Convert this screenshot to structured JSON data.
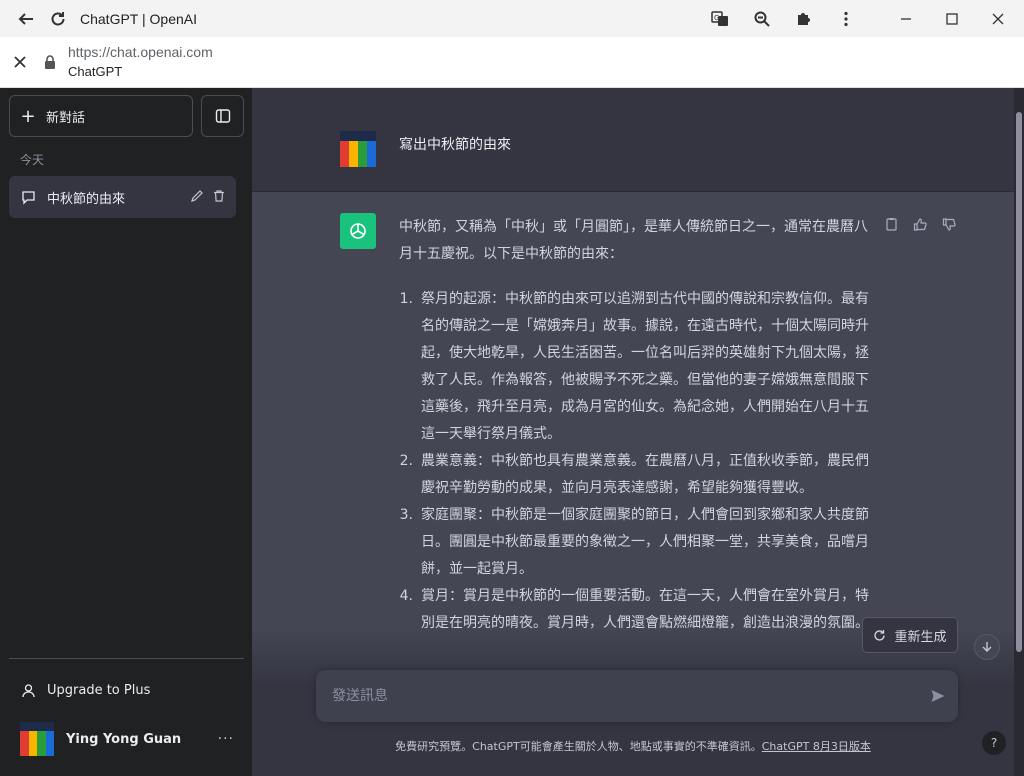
{
  "browser": {
    "tab_title": "ChatGPT | OpenAI",
    "url": "https://chat.openai.com",
    "site_name": "ChatGPT"
  },
  "sidebar": {
    "new_chat_label": "新對話",
    "section_today": "今天",
    "conversations": [
      {
        "title": "中秋節的由來"
      }
    ],
    "upgrade_label": "Upgrade to Plus",
    "user_name": "Ying Yong Guan",
    "more_label": "···"
  },
  "chat": {
    "user_message": "寫出中秋節的由來",
    "assistant_intro": "中秋節，又稱為「中秋」或「月圓節」，是華人傳統節日之一，通常在農曆八月十五慶祝。以下是中秋節的由來：",
    "assistant_list": [
      {
        "num": "1.",
        "text": "祭月的起源：中秋節的由來可以追溯到古代中國的傳說和宗教信仰。最有名的傳說之一是「嫦娥奔月」故事。據說，在遠古時代，十個太陽同時升起，使大地乾旱，人民生活困苦。一位名叫后羿的英雄射下九個太陽，拯救了人民。作為報答，他被賜予不死之藥。但當他的妻子嫦娥無意間服下這藥後，飛升至月亮，成為月宮的仙女。為紀念她，人們開始在八月十五這一天舉行祭月儀式。"
      },
      {
        "num": "2.",
        "text": "農業意義：中秋節也具有農業意義。在農曆八月，正值秋收季節，農民們慶祝辛勤勞動的成果，並向月亮表達感謝，希望能夠獲得豐收。"
      },
      {
        "num": "3.",
        "text": "家庭團聚：中秋節是一個家庭團聚的節日，人們會回到家鄉和家人共度節日。團圓是中秋節最重要的象徵之一，人們相聚一堂，共享美食，品嚐月餅，並一起賞月。"
      },
      {
        "num": "4.",
        "text": "賞月：賞月是中秋節的一個重要活動。在這一天，人們會在室外賞月，特別是在明亮的晴夜。賞月時，人們還會點燃細燈籠，創造出浪漫的氛圍。"
      }
    ],
    "regenerate_label": "重新生成",
    "input_placeholder": "發送訊息",
    "footer_text": "免費研究預覽。ChatGPT可能會產生關於人物、地點或事實的不準確資訊。",
    "footer_link": "ChatGPT 8月3日版本",
    "help_label": "?"
  },
  "colors": {
    "sidebar_bg": "#202123",
    "main_bg": "#343541",
    "bot_bg": "#444654",
    "openai_green": "#19c37d"
  }
}
